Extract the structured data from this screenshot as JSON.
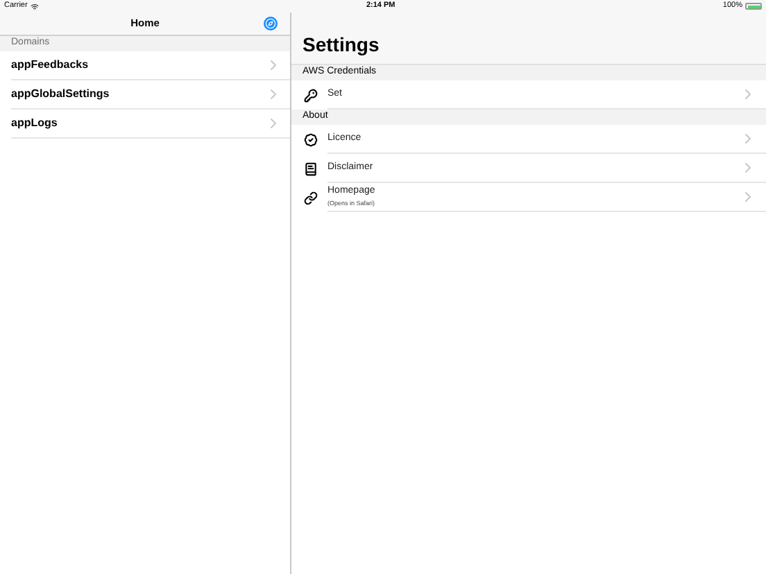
{
  "status_bar": {
    "carrier": "Carrier",
    "time": "2:14 PM",
    "battery": "100%"
  },
  "master": {
    "title": "Home",
    "section": "Domains",
    "items": [
      {
        "label": "appFeedbacks"
      },
      {
        "label": "appGlobalSettings"
      },
      {
        "label": "appLogs"
      }
    ]
  },
  "detail": {
    "title": "Settings",
    "sections": [
      {
        "header": "AWS Credentials",
        "rows": [
          {
            "kind": "key",
            "label": "Set"
          }
        ]
      },
      {
        "header": "About",
        "rows": [
          {
            "kind": "badge",
            "label": "Licence"
          },
          {
            "kind": "book",
            "label": "Disclaimer"
          },
          {
            "kind": "link",
            "label": "Homepage",
            "subtitle": "(Opens in Safari)"
          }
        ]
      }
    ]
  }
}
